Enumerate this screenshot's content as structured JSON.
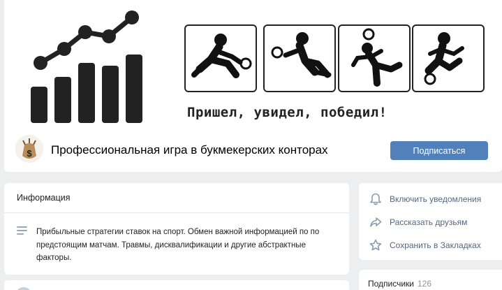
{
  "header": {
    "slogan": "Пришел, увидел, победил!",
    "community_name": "Профессиональная игра в букмекерских конторах",
    "subscribe_label": "Подписаться"
  },
  "info": {
    "title": "Информация",
    "description": "Прибыльные стратегии ставок на спорт. Обмен важной информацией по по предстоящим матчам. Травмы, дисквалификации и другие абстрактные факторы."
  },
  "actions": {
    "items": [
      {
        "label": "Включить уведомления",
        "icon": "bell-icon"
      },
      {
        "label": "Рассказать друзьям",
        "icon": "share-icon"
      },
      {
        "label": "Сохранить в Закладках",
        "icon": "star-icon"
      }
    ]
  },
  "followers": {
    "label": "Подписчики",
    "count": "126"
  },
  "colors": {
    "accent": "#5181b8",
    "background": "#edeef0",
    "dark": "#222222",
    "muted_text": "#55677d"
  }
}
